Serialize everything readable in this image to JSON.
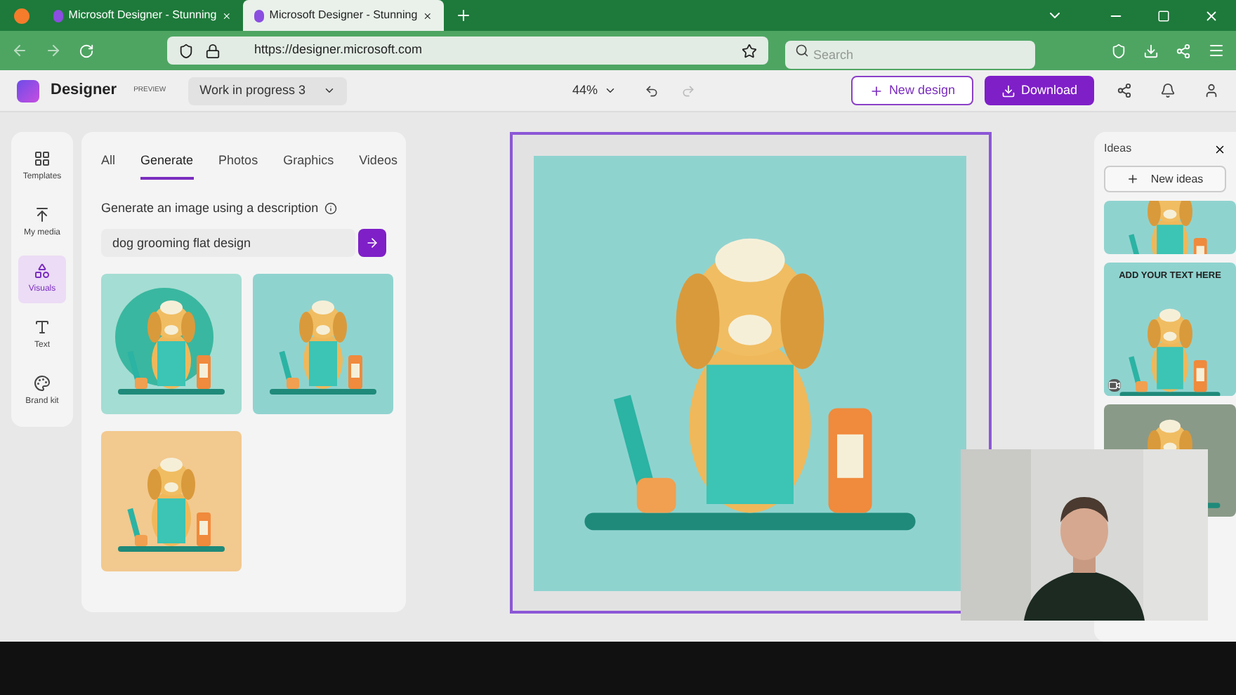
{
  "browser": {
    "tabs": [
      {
        "title": "Microsoft Designer - Stunning",
        "selected": false
      },
      {
        "title": "Microsoft Designer - Stunning",
        "selected": true
      }
    ],
    "url": "https://designer.microsoft.com",
    "search": {
      "placeholder": "Search"
    }
  },
  "header": {
    "app_name": "Designer",
    "badge": "PREVIEW",
    "project": "Work in progress 3",
    "zoom": "44%",
    "buttons": [
      "New design",
      "Download"
    ]
  },
  "rail": [
    {
      "label": "Templates",
      "selected": false
    },
    {
      "label": "My media",
      "selected": false
    },
    {
      "label": "Visuals",
      "selected": true
    },
    {
      "label": "Text",
      "selected": false
    },
    {
      "label": "Brand kit",
      "selected": false
    }
  ],
  "panel": {
    "tabs": [
      {
        "label": "All",
        "selected": false
      },
      {
        "label": "Generate",
        "selected": true
      },
      {
        "label": "Photos",
        "selected": false
      },
      {
        "label": "Graphics",
        "selected": false
      },
      {
        "label": "Videos",
        "selected": false
      }
    ],
    "prompt_label": "Generate an image using a description",
    "prompt_value": "dog grooming flat design",
    "results": [
      {
        "kind": "picture"
      },
      {
        "kind": "picture"
      },
      {
        "kind": "picture"
      }
    ]
  },
  "ideas": {
    "title": "Ideas",
    "button": "New ideas",
    "cards": [
      {
        "kind": "picture"
      },
      {
        "kind": "template",
        "heading": "ADD YOUR TEXT HERE"
      },
      {
        "kind": "picture"
      }
    ]
  }
}
